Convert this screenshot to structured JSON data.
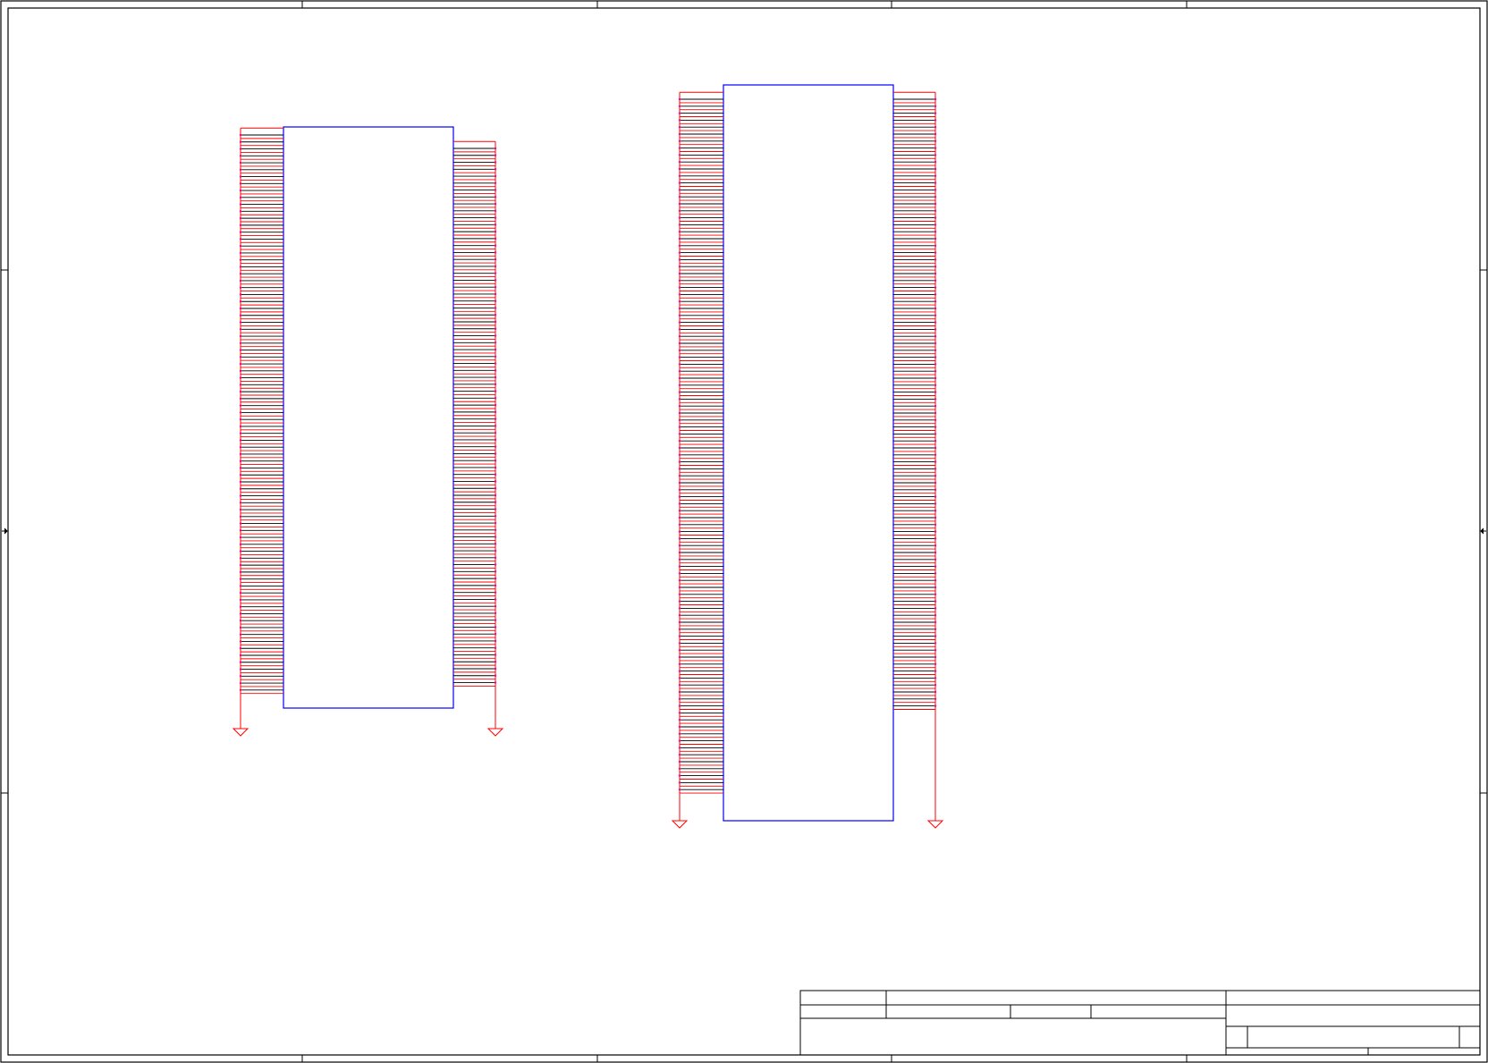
{
  "sheet": {
    "colors": {
      "frame": "#000000",
      "component_outline": "#0000ff",
      "wire": "#ff0000",
      "pin_line": "#000000",
      "pin_dot": "#ff00ff",
      "ground_symbol": "#ff0000"
    }
  },
  "components": [
    {
      "id": "connector-left",
      "left_pins": 81,
      "right_pins": 78,
      "ground_symbols": 2
    },
    {
      "id": "connector-right",
      "left_pins": 100,
      "right_pins": 88,
      "ground_symbols": 2
    }
  ],
  "title_block": {
    "text_fields": []
  }
}
